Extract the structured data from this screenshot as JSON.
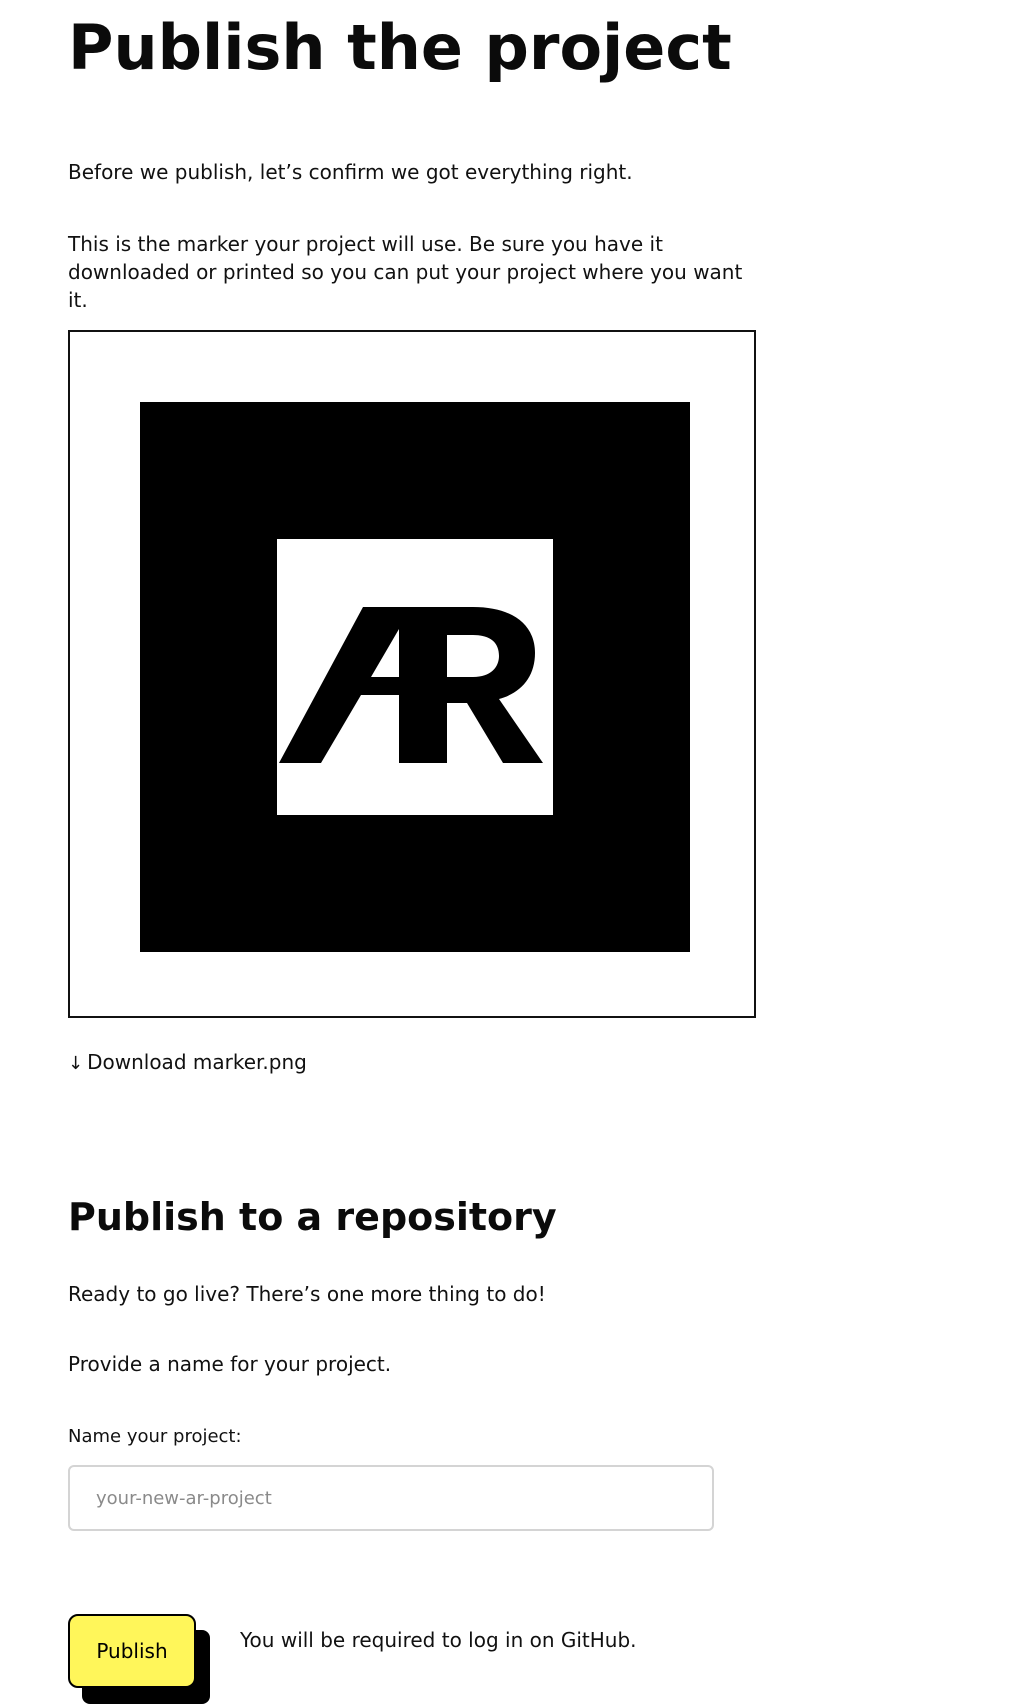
{
  "page": {
    "title": "Publish the project",
    "intro": "Before we publish, let’s confirm we got everything right.",
    "marker_description": "This is the marker your project will use. Be sure you have it downloaded or printed so you can put your project where you want it."
  },
  "marker": {
    "logo_text": "AR",
    "download_icon": "↓",
    "download_label": "Download marker.png"
  },
  "publish_section": {
    "title": "Publish to a repository",
    "ready_text": "Ready to go live? There’s one more thing to do!",
    "provide_text": "Provide a name for your project.",
    "name_label": "Name your project:",
    "name_placeholder": "your-new-ar-project",
    "name_value": "",
    "publish_label": "Publish",
    "login_note": "You will be required to log in on GitHub."
  },
  "colors": {
    "publish_button": "#fff65a",
    "text": "#111111",
    "input_border": "#d4d4d4"
  }
}
